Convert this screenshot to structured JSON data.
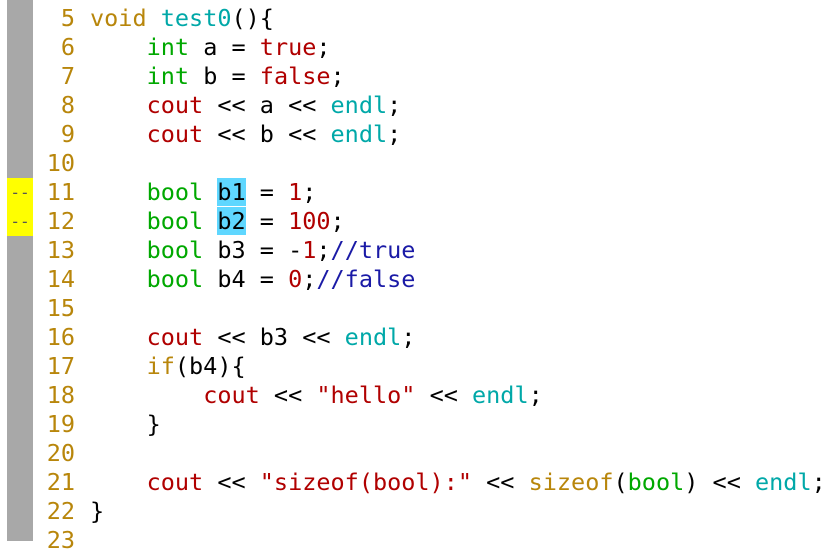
{
  "lines": [
    {
      "num": "5",
      "mark": "",
      "tokens": [
        {
          "t": "void",
          "c": "kw"
        },
        {
          "t": " ",
          "c": "pl"
        },
        {
          "t": "test0",
          "c": "fn"
        },
        {
          "t": "(){",
          "c": "pl"
        }
      ]
    },
    {
      "num": "6",
      "mark": "",
      "tokens": [
        {
          "t": "    ",
          "c": "pl"
        },
        {
          "t": "int",
          "c": "ty"
        },
        {
          "t": " a = ",
          "c": "pl"
        },
        {
          "t": "true",
          "c": "lit"
        },
        {
          "t": ";",
          "c": "pl"
        }
      ]
    },
    {
      "num": "7",
      "mark": "",
      "tokens": [
        {
          "t": "    ",
          "c": "pl"
        },
        {
          "t": "int",
          "c": "ty"
        },
        {
          "t": " b = ",
          "c": "pl"
        },
        {
          "t": "false",
          "c": "lit"
        },
        {
          "t": ";",
          "c": "pl"
        }
      ]
    },
    {
      "num": "8",
      "mark": "",
      "tokens": [
        {
          "t": "    ",
          "c": "pl"
        },
        {
          "t": "cout",
          "c": "lit"
        },
        {
          "t": " << a << ",
          "c": "pl"
        },
        {
          "t": "endl",
          "c": "fn"
        },
        {
          "t": ";",
          "c": "pl"
        }
      ]
    },
    {
      "num": "9",
      "mark": "",
      "tokens": [
        {
          "t": "    ",
          "c": "pl"
        },
        {
          "t": "cout",
          "c": "lit"
        },
        {
          "t": " << b << ",
          "c": "pl"
        },
        {
          "t": "endl",
          "c": "fn"
        },
        {
          "t": ";",
          "c": "pl"
        }
      ]
    },
    {
      "num": "10",
      "mark": "",
      "tokens": []
    },
    {
      "num": "11",
      "mark": "--",
      "tokens": [
        {
          "t": "    ",
          "c": "pl"
        },
        {
          "t": "bool",
          "c": "ty"
        },
        {
          "t": " ",
          "c": "pl"
        },
        {
          "t": "b1",
          "c": "pl hl"
        },
        {
          "t": " = ",
          "c": "pl"
        },
        {
          "t": "1",
          "c": "lit"
        },
        {
          "t": ";",
          "c": "pl"
        }
      ]
    },
    {
      "num": "12",
      "mark": "--",
      "tokens": [
        {
          "t": "    ",
          "c": "pl"
        },
        {
          "t": "bool",
          "c": "ty"
        },
        {
          "t": " ",
          "c": "pl"
        },
        {
          "t": "b2",
          "c": "pl hl"
        },
        {
          "t": " = ",
          "c": "pl"
        },
        {
          "t": "100",
          "c": "lit"
        },
        {
          "t": ";",
          "c": "pl"
        }
      ]
    },
    {
      "num": "13",
      "mark": "",
      "tokens": [
        {
          "t": "    ",
          "c": "pl"
        },
        {
          "t": "bool",
          "c": "ty"
        },
        {
          "t": " b3 = -",
          "c": "pl"
        },
        {
          "t": "1",
          "c": "lit"
        },
        {
          "t": ";",
          "c": "pl"
        },
        {
          "t": "//true",
          "c": "cm"
        }
      ]
    },
    {
      "num": "14",
      "mark": "",
      "tokens": [
        {
          "t": "    ",
          "c": "pl"
        },
        {
          "t": "bool",
          "c": "ty"
        },
        {
          "t": " b4 = ",
          "c": "pl"
        },
        {
          "t": "0",
          "c": "lit"
        },
        {
          "t": ";",
          "c": "pl"
        },
        {
          "t": "//false",
          "c": "cm"
        }
      ]
    },
    {
      "num": "15",
      "mark": "",
      "tokens": []
    },
    {
      "num": "16",
      "mark": "",
      "tokens": [
        {
          "t": "    ",
          "c": "pl"
        },
        {
          "t": "cout",
          "c": "lit"
        },
        {
          "t": " << b3 << ",
          "c": "pl"
        },
        {
          "t": "endl",
          "c": "fn"
        },
        {
          "t": ";",
          "c": "pl"
        }
      ]
    },
    {
      "num": "17",
      "mark": "",
      "tokens": [
        {
          "t": "    ",
          "c": "pl"
        },
        {
          "t": "if",
          "c": "kw"
        },
        {
          "t": "(b4){",
          "c": "pl"
        }
      ]
    },
    {
      "num": "18",
      "mark": "",
      "tokens": [
        {
          "t": "        ",
          "c": "pl"
        },
        {
          "t": "cout",
          "c": "lit"
        },
        {
          "t": " << ",
          "c": "pl"
        },
        {
          "t": "\"hello\"",
          "c": "lit"
        },
        {
          "t": " << ",
          "c": "pl"
        },
        {
          "t": "endl",
          "c": "fn"
        },
        {
          "t": ";",
          "c": "pl"
        }
      ]
    },
    {
      "num": "19",
      "mark": "",
      "tokens": [
        {
          "t": "    }",
          "c": "pl"
        }
      ]
    },
    {
      "num": "20",
      "mark": "",
      "tokens": []
    },
    {
      "num": "21",
      "mark": "",
      "tokens": [
        {
          "t": "    ",
          "c": "pl"
        },
        {
          "t": "cout",
          "c": "lit"
        },
        {
          "t": " << ",
          "c": "pl"
        },
        {
          "t": "\"sizeof(bool):\"",
          "c": "lit"
        },
        {
          "t": " << ",
          "c": "pl"
        },
        {
          "t": "sizeof",
          "c": "kw"
        },
        {
          "t": "(",
          "c": "pl"
        },
        {
          "t": "bool",
          "c": "ty"
        },
        {
          "t": ") << ",
          "c": "pl"
        },
        {
          "t": "endl",
          "c": "fn"
        },
        {
          "t": ";",
          "c": "pl"
        }
      ]
    },
    {
      "num": "22",
      "mark": "",
      "tokens": [
        {
          "t": "}",
          "c": "pl"
        }
      ]
    },
    {
      "num": "23",
      "mark": "",
      "tokens": []
    }
  ],
  "colors": {
    "keyword": "#b8860b",
    "type": "#00a800",
    "function": "#00a8a8",
    "literal": "#b00000",
    "comment": "#1a1aa6",
    "search_highlight": "#5fd7ff",
    "change_mark": "#ffff00",
    "gutter": "#a8a8a8"
  }
}
